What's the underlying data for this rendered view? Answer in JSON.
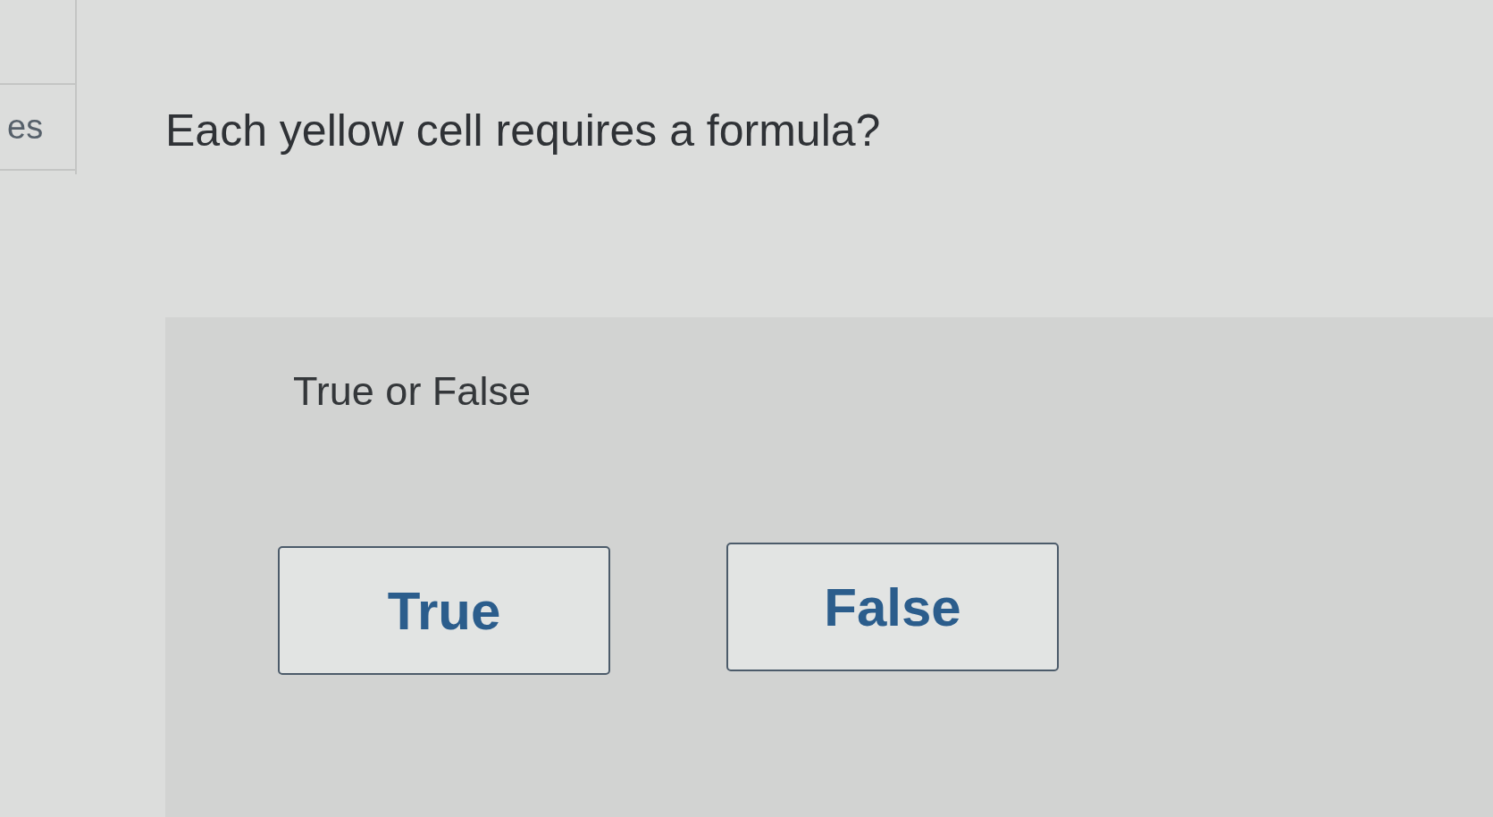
{
  "sidebar": {
    "items": [
      {
        "label": "es"
      }
    ]
  },
  "question": {
    "prompt": "Each yellow cell requires a formula?"
  },
  "answer_panel": {
    "instruction": "True or False",
    "options": [
      {
        "label": "True",
        "selected": false
      },
      {
        "label": "False",
        "selected": false
      }
    ]
  }
}
